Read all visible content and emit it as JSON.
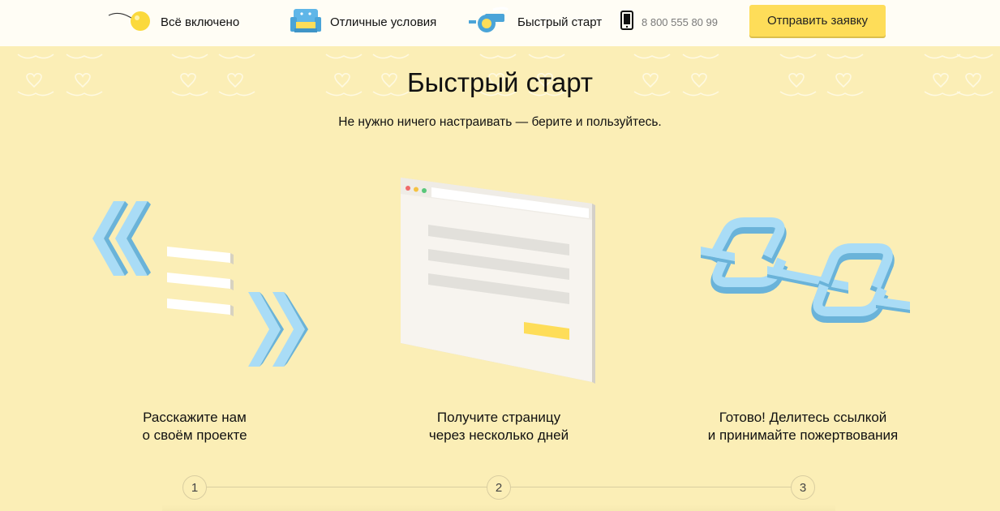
{
  "nav": {
    "items": [
      {
        "label": "Всё включено",
        "icon": "balloon-icon"
      },
      {
        "label": "Отличные условия",
        "icon": "armchair-icon"
      },
      {
        "label": "Быстрый старт",
        "icon": "whistle-icon"
      }
    ],
    "phone": "8 800 555 80 99",
    "cta_label": "Отправить заявку"
  },
  "section": {
    "title": "Быстрый старт",
    "subtitle": "Не нужно ничего настраивать — берите и пользуйтесь."
  },
  "steps": [
    {
      "number": "1",
      "line1": "Расскажите нам",
      "line2": "о своём проекте",
      "icon": "form-arrows-icon"
    },
    {
      "number": "2",
      "line1": "Получите страницу",
      "line2": "через несколько дней",
      "icon": "browser-window-icon"
    },
    {
      "number": "3",
      "line1": "Готово! Делитесь ссылкой",
      "line2": "и принимайте пожертвования",
      "icon": "chain-link-icon"
    }
  ],
  "colors": {
    "accent": "#fedd59",
    "background": "#fbeeb6",
    "icon_blue": "#a9dcf6",
    "icon_blue_dark": "#6ab3d9"
  }
}
